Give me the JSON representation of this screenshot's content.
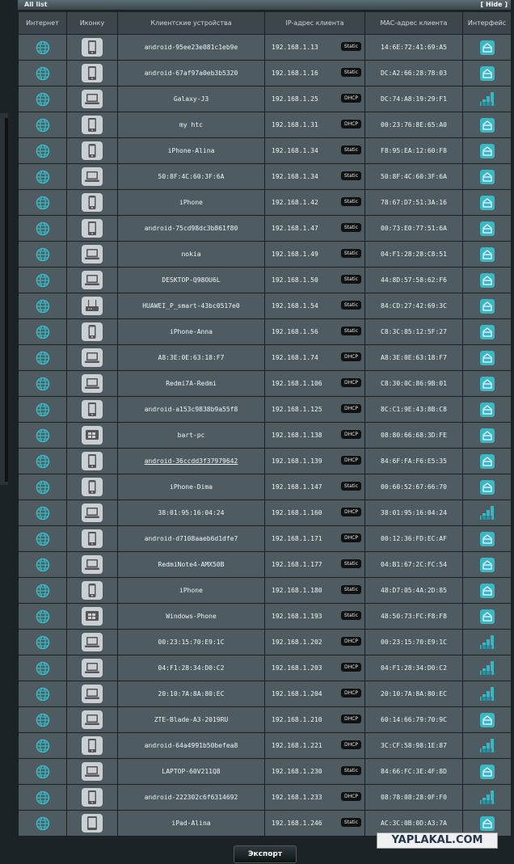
{
  "title": "All list",
  "hide_label": "[ Hide ]",
  "headers": [
    "Интернет",
    "Иконку",
    "Клиентские устройства",
    "IP-адрес клиента",
    "MAC-адрес клиента",
    "Интерфейс"
  ],
  "export_label": "Экспорт",
  "watermark": "YAPLAKAL.COM",
  "colors": {
    "accent": "#39b7c4",
    "row_bg": "#4e5b61",
    "header_bg": "#3c474c",
    "badge_bg": "#111111"
  },
  "rows": [
    {
      "name": "android-95ee23e081c1eb9e",
      "ip": "192.168.1.13",
      "type": "Static",
      "mac": "14:6E:72:41:69:A5",
      "icon": "phone",
      "iface": "wired"
    },
    {
      "name": "android-67af97a0eb3b5320",
      "ip": "192.168.1.16",
      "type": "Static",
      "mac": "DC:A2:66:28:78:03",
      "icon": "phone",
      "iface": "wired"
    },
    {
      "name": "Galaxy-J3",
      "ip": "192.168.1.25",
      "type": "DHCP",
      "mac": "DC:74:A8:19:29:F1",
      "icon": "laptop",
      "iface": "wifi"
    },
    {
      "name": "my htc",
      "ip": "192.168.1.31",
      "type": "DHCP",
      "mac": "00:23:76:8E:65:A0",
      "icon": "phone",
      "iface": "wired"
    },
    {
      "name": "iPhone-Alina",
      "ip": "192.168.1.34",
      "type": "Static",
      "mac": "F8:95:EA:12:60:F8",
      "icon": "iphone",
      "iface": "wired"
    },
    {
      "name": "50:8F:4C:60:3F:6A",
      "ip": "192.168.1.34",
      "type": "Static",
      "mac": "50:8F:4C:60:3F:6A",
      "icon": "laptop",
      "iface": "wired"
    },
    {
      "name": "iPhone",
      "ip": "192.168.1.42",
      "type": "Static",
      "mac": "78:67:D7:51:3A:16",
      "icon": "iphone",
      "iface": "wired"
    },
    {
      "name": "android-75cd98dc3b861f80",
      "ip": "192.168.1.47",
      "type": "Static",
      "mac": "00:73:E0:77:51:6A",
      "icon": "phone",
      "iface": "wired"
    },
    {
      "name": "nokia",
      "ip": "192.168.1.49",
      "type": "Static",
      "mac": "04:F1:28:28:C8:51",
      "icon": "laptop",
      "iface": "wired"
    },
    {
      "name": "DESKTOP-Q98OU6L",
      "ip": "192.168.1.50",
      "type": "Static",
      "mac": "44:8D:57:58:62:F6",
      "icon": "laptop",
      "iface": "wired"
    },
    {
      "name": "HUAWEI_P_smart-43bc0517e0",
      "ip": "192.168.1.54",
      "type": "Static",
      "mac": "84:CD:27:42:69:3C",
      "icon": "router",
      "iface": "wired"
    },
    {
      "name": "iPhone-Anna",
      "ip": "192.168.1.56",
      "type": "Static",
      "mac": "C8:3C:85:12:5F:27",
      "icon": "iphone",
      "iface": "wired"
    },
    {
      "name": "A8:3E:0E:63:18:F7",
      "ip": "192.168.1.74",
      "type": "DHCP",
      "mac": "A8:3E:0E:63:18:F7",
      "icon": "laptop",
      "iface": "wired"
    },
    {
      "name": "Redmi7A-Redmi",
      "ip": "192.168.1.106",
      "type": "DHCP",
      "mac": "C8:30:0C:86:9B:01",
      "icon": "laptop",
      "iface": "wired"
    },
    {
      "name": "android-a153c9838b9a55f8",
      "ip": "192.168.1.125",
      "type": "DHCP",
      "mac": "8C:C1:9E:43:8B:C8",
      "icon": "phone",
      "iface": "wired"
    },
    {
      "name": "bart-pc",
      "ip": "192.168.1.138",
      "type": "DHCP",
      "mac": "08:80:66:68:3D:FE",
      "icon": "windows",
      "iface": "wired"
    },
    {
      "name": "android-36ccdd3f37979642",
      "ip": "192.168.1.139",
      "type": "DHCP",
      "mac": "84:6F:FA:F6:E5:35",
      "icon": "phone",
      "iface": "wired",
      "link": true
    },
    {
      "name": "iPhone-Dima",
      "ip": "192.168.1.147",
      "type": "Static",
      "mac": "00:60:52:67:66:70",
      "icon": "iphone",
      "iface": "wired"
    },
    {
      "name": "38:01:95:16:04:24",
      "ip": "192.168.1.160",
      "type": "DHCP",
      "mac": "38:01:95:16:04:24",
      "icon": "laptop",
      "iface": "wifi"
    },
    {
      "name": "android-d7108aaeb6d1dfe7",
      "ip": "192.168.1.171",
      "type": "DHCP",
      "mac": "00:12:36:FD:EC:AF",
      "icon": "phone",
      "iface": "wired"
    },
    {
      "name": "RedmiNote4-AMX50B",
      "ip": "192.168.1.177",
      "type": "Static",
      "mac": "04:B1:67:2C:FC:54",
      "icon": "laptop",
      "iface": "wired"
    },
    {
      "name": "iPhone",
      "ip": "192.168.1.180",
      "type": "Static",
      "mac": "48:D7:05:4A:2D:85",
      "icon": "iphone",
      "iface": "wired"
    },
    {
      "name": "Windows-Phone",
      "ip": "192.168.1.193",
      "type": "Static",
      "mac": "48:50:73:FC:F8:F8",
      "icon": "windows",
      "iface": "wired"
    },
    {
      "name": "00:23:15:70:E9:1C",
      "ip": "192.168.1.202",
      "type": "DHCP",
      "mac": "00:23:15:70:E9:1C",
      "icon": "laptop",
      "iface": "wifi"
    },
    {
      "name": "04:F1:28:34:D0:C2",
      "ip": "192.168.1.203",
      "type": "DHCP",
      "mac": "04:F1:28:34:D0:C2",
      "icon": "laptop",
      "iface": "wifi"
    },
    {
      "name": "20:10:7A:8A:80:EC",
      "ip": "192.168.1.204",
      "type": "DHCP",
      "mac": "20:10:7A:8A:80:EC",
      "icon": "laptop",
      "iface": "wifi"
    },
    {
      "name": "ZTE-Blade-A3-2019RU",
      "ip": "192.168.1.210",
      "type": "DHCP",
      "mac": "60:14:66:79:70:9C",
      "icon": "laptop",
      "iface": "wired"
    },
    {
      "name": "android-64a4991b50befea8",
      "ip": "192.168.1.221",
      "type": "DHCP",
      "mac": "3C:CF:58:98:1E:87",
      "icon": "phone",
      "iface": "wifi"
    },
    {
      "name": "LAPTOP-60V211Q8",
      "ip": "192.168.1.230",
      "type": "Static",
      "mac": "84:66:FC:3E:4F:8D",
      "icon": "laptop",
      "iface": "wired"
    },
    {
      "name": "android-222302c6f6314692",
      "ip": "192.168.1.233",
      "type": "DHCP",
      "mac": "08:78:08:28:0F:F0",
      "icon": "phone",
      "iface": "wifi"
    },
    {
      "name": "iPad-Alina",
      "ip": "192.168.1.246",
      "type": "Static",
      "mac": "AC:3C:0B:0D:A3:7A",
      "icon": "tablet",
      "iface": "wired"
    }
  ]
}
